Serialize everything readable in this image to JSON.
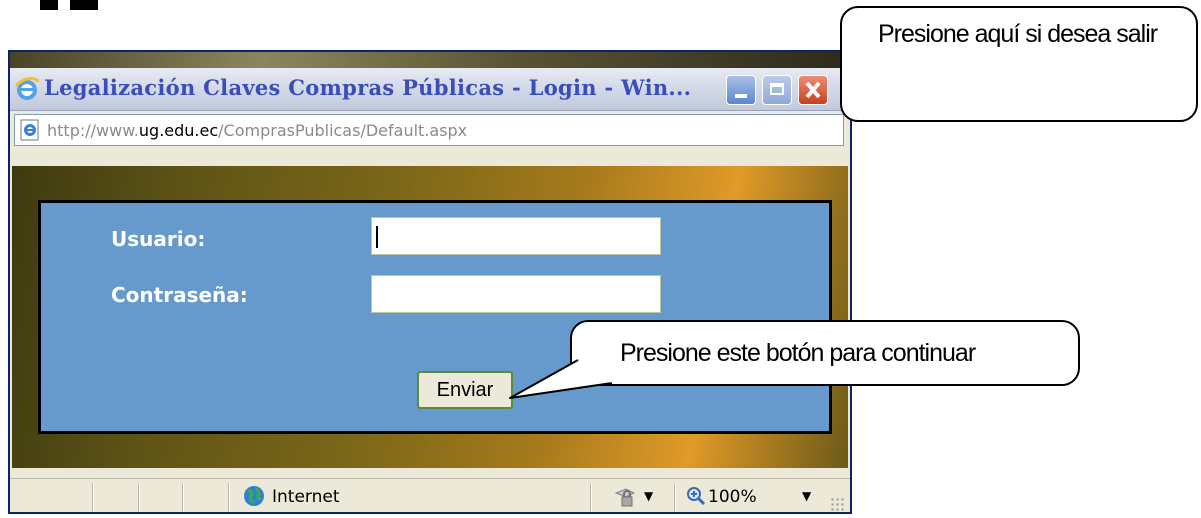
{
  "window": {
    "title": "Legalización Claves Compras Públicas - Login - Win...",
    "url_prefix": "http://www.",
    "url_host": "ug.edu.ec",
    "url_path": "/ComprasPublicas/Default.aspx"
  },
  "login": {
    "user_label": "Usuario:",
    "password_label": "Contraseña:",
    "user_value": "",
    "password_value": "",
    "submit_label": "Enviar"
  },
  "statusbar": {
    "zone_text": "Internet",
    "zoom_text": "100%"
  },
  "callouts": {
    "exit_text": "Presione aquí si desea salir",
    "continue_text": "Presione este botón para continuar"
  },
  "icons": [
    "ie-logo-icon",
    "page-icon",
    "minimize-icon",
    "maximize-icon",
    "close-icon",
    "globe-icon",
    "lock-icon",
    "zoom-icon",
    "chevron-down-icon",
    "resize-grip-icon"
  ],
  "colors": {
    "login_panel": "#6699cc",
    "title_text": "#3a4dba",
    "close_button": "#c8401e"
  }
}
